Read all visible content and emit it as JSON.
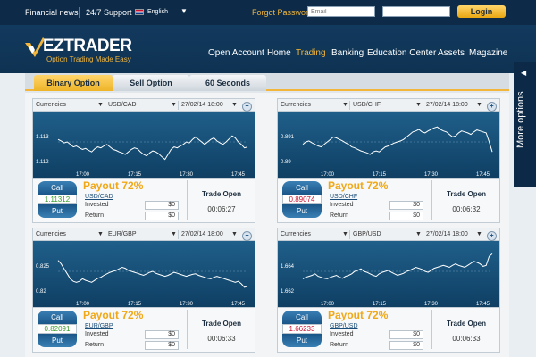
{
  "topbar": {
    "financial_news": "Financial news",
    "support": "24/7 Support",
    "language": "English",
    "forgot_password": "Forgot Password?",
    "email_placeholder": "Email",
    "password_placeholder": "",
    "login_label": "Login"
  },
  "brand": {
    "name": "EZTRADER",
    "tagline": "Option Trading Made Easy",
    "accent": "#f3b53a",
    "navy": "#0e3252"
  },
  "nav": {
    "items": [
      {
        "label": "Open Account"
      },
      {
        "label": "Home"
      },
      {
        "label": "Trading"
      },
      {
        "label": "Banking"
      },
      {
        "label": "Education Center"
      },
      {
        "label": "Assets"
      },
      {
        "label": "Magazine"
      }
    ],
    "active": "Trading"
  },
  "side_tab": {
    "label": "More options"
  },
  "tabs": [
    {
      "label": "Binary Option"
    },
    {
      "label": "Sell Option"
    },
    {
      "label": "60 Seconds"
    }
  ],
  "widgets": [
    {
      "category": "Currencies",
      "pair": "USD/CAD",
      "expiry": "27/02/14 18:00",
      "y_ticks": [
        "1.113",
        "1.112"
      ],
      "x_ticks": [
        "17:00",
        "17:15",
        "17:30",
        "17:45"
      ],
      "series": [
        0.55,
        0.52,
        0.48,
        0.5,
        0.45,
        0.4,
        0.42,
        0.38,
        0.35,
        0.37,
        0.33,
        0.3,
        0.36,
        0.4,
        0.38,
        0.42,
        0.45,
        0.4,
        0.35,
        0.33,
        0.3,
        0.28,
        0.25,
        0.3,
        0.35,
        0.38,
        0.36,
        0.3,
        0.25,
        0.22,
        0.28,
        0.32,
        0.3,
        0.26,
        0.2,
        0.15,
        0.25,
        0.35,
        0.4,
        0.38,
        0.42,
        0.45,
        0.5,
        0.48,
        0.55,
        0.6,
        0.55,
        0.5,
        0.45,
        0.5,
        0.55,
        0.58,
        0.52,
        0.48,
        0.45,
        0.5,
        0.56,
        0.62,
        0.58,
        0.5,
        0.45,
        0.38,
        0.4
      ],
      "call": "Call",
      "price": "1.11312",
      "price_trend": "up",
      "put": "Put",
      "payout": "Payout 72%",
      "invested_label": "Invested",
      "invested": "$0",
      "return_label": "Return",
      "return": "$0",
      "status": "Trade Open",
      "timer": "00:06:27"
    },
    {
      "category": "Currencies",
      "pair": "USD/CHF",
      "expiry": "27/02/14 18:00",
      "y_ticks": [
        "0.891",
        "0.89"
      ],
      "x_ticks": [
        "17:00",
        "17:15",
        "17:30",
        "17:45"
      ],
      "series": [
        0.45,
        0.5,
        0.52,
        0.48,
        0.45,
        0.42,
        0.4,
        0.45,
        0.5,
        0.55,
        0.6,
        0.58,
        0.55,
        0.52,
        0.48,
        0.45,
        0.4,
        0.38,
        0.35,
        0.32,
        0.3,
        0.28,
        0.25,
        0.3,
        0.32,
        0.3,
        0.35,
        0.4,
        0.42,
        0.45,
        0.48,
        0.5,
        0.52,
        0.55,
        0.6,
        0.65,
        0.7,
        0.72,
        0.75,
        0.7,
        0.68,
        0.72,
        0.75,
        0.78,
        0.8,
        0.75,
        0.72,
        0.7,
        0.65,
        0.6,
        0.62,
        0.68,
        0.72,
        0.7,
        0.68,
        0.65,
        0.7,
        0.74,
        0.72,
        0.7,
        0.68,
        0.5,
        0.3
      ],
      "call": "Call",
      "price": "0.89074",
      "price_trend": "down",
      "put": "Put",
      "payout": "Payout 72%",
      "invested_label": "Invested",
      "invested": "$0",
      "return_label": "Return",
      "return": "$0",
      "status": "Trade Open",
      "timer": "00:06:32"
    },
    {
      "category": "Currencies",
      "pair": "EUR/GBP",
      "expiry": "27/02/14 18:00",
      "y_ticks": [
        "0.825",
        "0.82"
      ],
      "x_ticks": [
        "17:00",
        "17:15",
        "17:30",
        "17:45"
      ],
      "series": [
        0.72,
        0.65,
        0.55,
        0.45,
        0.35,
        0.3,
        0.28,
        0.3,
        0.35,
        0.32,
        0.3,
        0.28,
        0.32,
        0.36,
        0.38,
        0.42,
        0.45,
        0.48,
        0.5,
        0.52,
        0.55,
        0.58,
        0.56,
        0.52,
        0.5,
        0.48,
        0.46,
        0.44,
        0.42,
        0.45,
        0.48,
        0.5,
        0.46,
        0.44,
        0.42,
        0.4,
        0.42,
        0.45,
        0.48,
        0.46,
        0.44,
        0.42,
        0.4,
        0.42,
        0.44,
        0.45,
        0.42,
        0.4,
        0.38,
        0.36,
        0.35,
        0.38,
        0.4,
        0.38,
        0.36,
        0.34,
        0.32,
        0.3,
        0.28,
        0.3,
        0.25,
        0.18,
        0.2
      ],
      "call": "Call",
      "price": "0.82091",
      "price_trend": "up",
      "put": "Put",
      "payout": "Payout 72%",
      "invested_label": "Invested",
      "invested": "$0",
      "return_label": "Return",
      "return": "$0",
      "status": "Trade Open",
      "timer": "00:06:33"
    },
    {
      "category": "Currencies",
      "pair": "GBP/USD",
      "expiry": "27/02/14 18:00",
      "y_ticks": [
        "1.664",
        "1.662"
      ],
      "x_ticks": [
        "17:00",
        "17:15",
        "17:30",
        "17:45"
      ],
      "series": [
        0.35,
        0.38,
        0.4,
        0.42,
        0.45,
        0.4,
        0.38,
        0.36,
        0.35,
        0.38,
        0.4,
        0.42,
        0.38,
        0.36,
        0.4,
        0.42,
        0.45,
        0.5,
        0.52,
        0.55,
        0.5,
        0.48,
        0.45,
        0.42,
        0.4,
        0.45,
        0.48,
        0.5,
        0.52,
        0.48,
        0.45,
        0.42,
        0.44,
        0.46,
        0.5,
        0.52,
        0.55,
        0.58,
        0.56,
        0.54,
        0.5,
        0.48,
        0.52,
        0.56,
        0.58,
        0.6,
        0.62,
        0.6,
        0.58,
        0.62,
        0.65,
        0.62,
        0.6,
        0.58,
        0.62,
        0.66,
        0.7,
        0.68,
        0.65,
        0.6,
        0.62,
        0.8,
        0.85
      ],
      "call": "Call",
      "price": "1.66233",
      "price_trend": "down",
      "put": "Put",
      "payout": "Payout 72%",
      "invested_label": "Invested",
      "invested": "$0",
      "return_label": "Return",
      "return": "$0",
      "status": "Trade Open",
      "timer": "00:06:33"
    }
  ]
}
